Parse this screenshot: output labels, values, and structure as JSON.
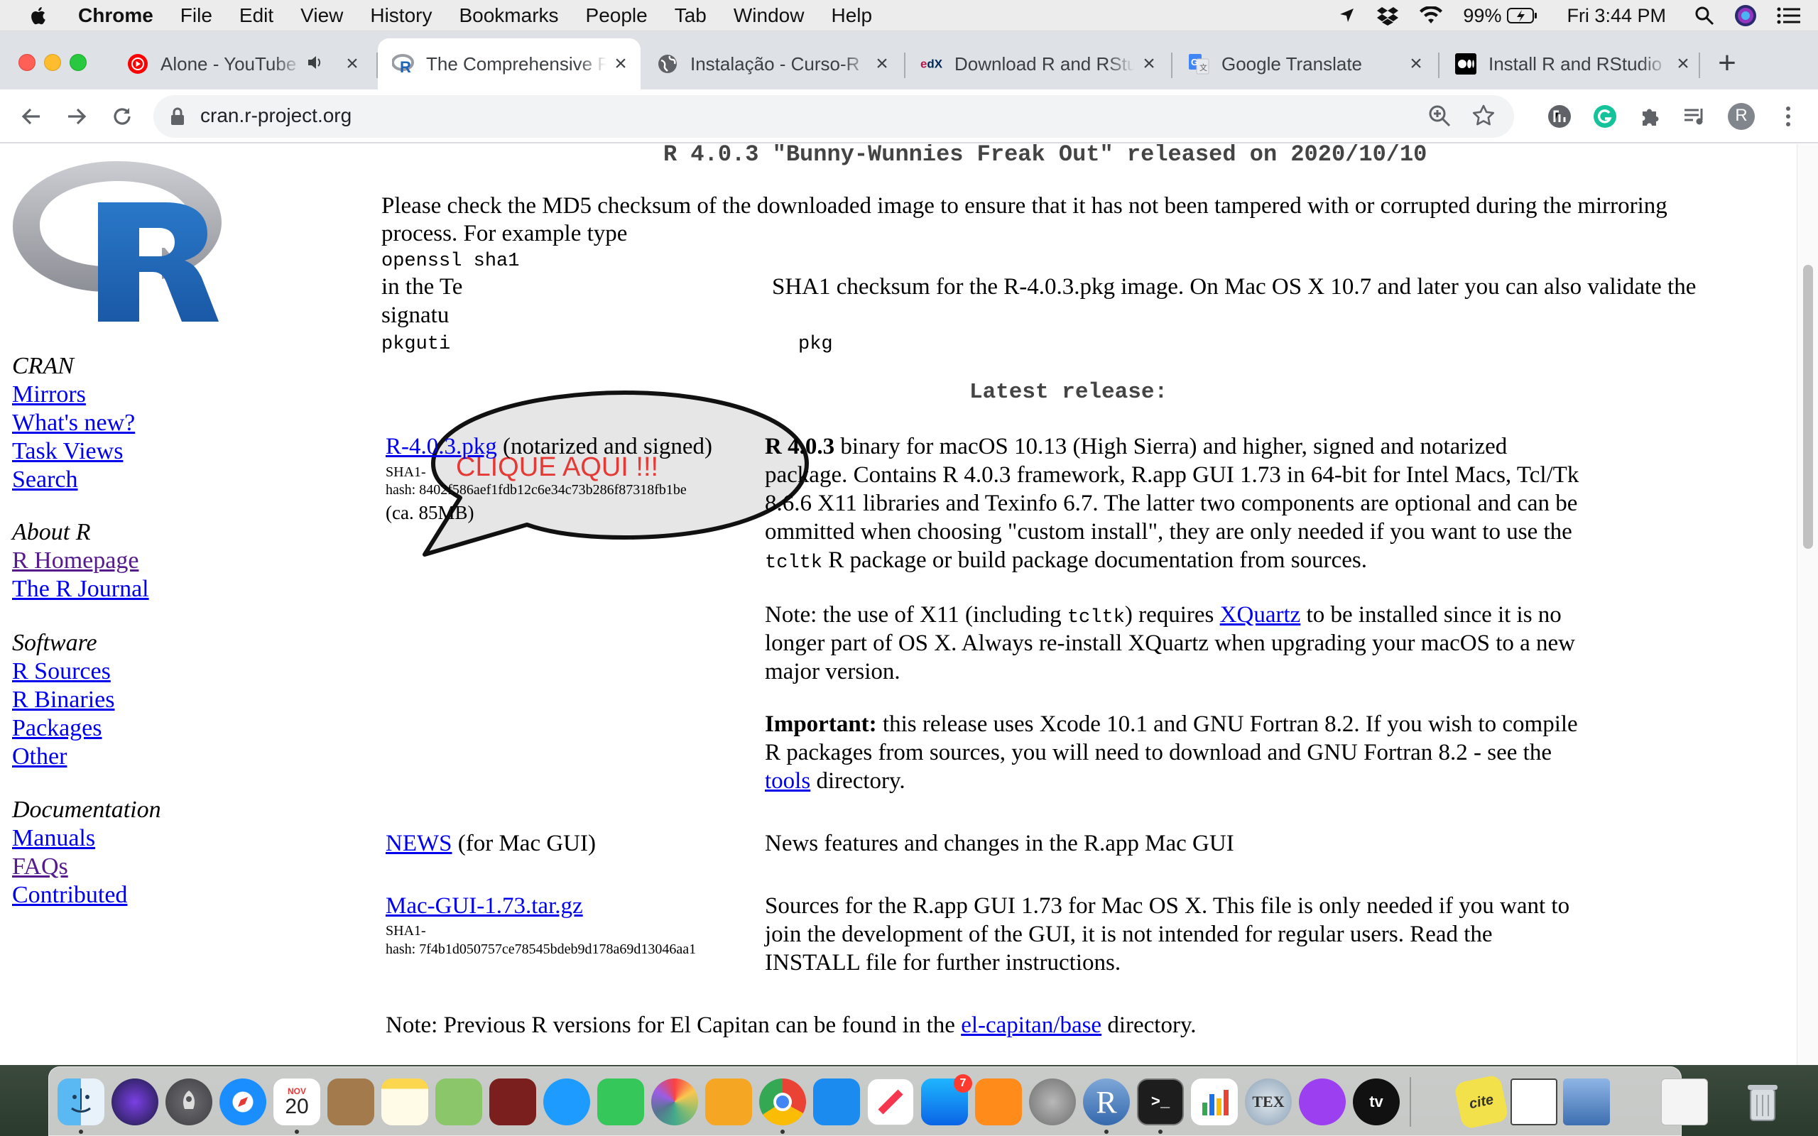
{
  "menubar": {
    "apple_icon": "apple-icon",
    "items": [
      "Chrome",
      "File",
      "Edit",
      "View",
      "History",
      "Bookmarks",
      "People",
      "Tab",
      "Window",
      "Help"
    ],
    "battery": "99%",
    "clock": "Fri 3:44 PM"
  },
  "tabs": [
    {
      "title": "Alone - YouTube Music",
      "icon": "youtube-music-icon",
      "active": false
    },
    {
      "title": "The Comprehensive R Archive Network",
      "icon": "r-logo-icon",
      "active": true
    },
    {
      "title": "Instalação - Curso-R",
      "icon": "globe-icon",
      "active": false
    },
    {
      "title": "Download R and RStudio",
      "icon": "edx-icon",
      "active": false
    },
    {
      "title": "Google Translate",
      "icon": "google-translate-icon",
      "active": false
    },
    {
      "title": "Install R and RStudio",
      "icon": "medium-icon",
      "active": false
    }
  ],
  "toolbar": {
    "url": "cran.r-project.org",
    "profile_initial": "R"
  },
  "sidebar": {
    "cran_heading": "CRAN",
    "cran_links": [
      "Mirrors",
      "What's new?",
      "Task Views",
      "Search"
    ],
    "about_heading": "About R",
    "about_links": [
      "R Homepage",
      "The R Journal"
    ],
    "software_heading": "Software",
    "software_links": [
      "R Sources",
      "R Binaries",
      "Packages",
      "Other"
    ],
    "docs_heading": "Documentation",
    "docs_links": [
      "Manuals",
      "FAQs",
      "Contributed"
    ]
  },
  "content": {
    "release_title": "R 4.0.3 \"Bunny-Wunnies Freak Out\" released on 2020/10/10",
    "md5_line1": "Please check the MD5 checksum of the downloaded image to ensure that it has not been tampered with or corrupted during the mirroring",
    "md5_line2": "process. For example type",
    "openssl_cmd": "openssl sha1",
    "in_the": "in the Te",
    "sha1_rest": "SHA1 checksum for the R-4.0.3.pkg image. On Mac OS X 10.7 and later you can also validate the",
    "signature": "signatu",
    "pkgutil": "pkguti",
    "pkg_end": "pkg",
    "latest_release": "Latest release:",
    "pkg_link": "R-4.0.3.pkg",
    "pkg_note": "(notarized and signed)",
    "pkg_sha_label": "SHA1-",
    "pkg_hash": "hash: 8402f586aef1fdb12c6e34c73b286f87318fb1be",
    "pkg_size": "(ca. 85MB)",
    "desc_bold": "R 4.0.3",
    "desc_l1": " binary for macOS 10.13 (High Sierra) and higher, signed and notarized",
    "desc_l2": "package. Contains R 4.0.3 framework, R.app GUI 1.73 in 64-bit for Intel Macs, Tcl/Tk",
    "desc_l3": "8.6.6 X11 libraries and Texinfo 6.7. The latter two components are optional and can be",
    "desc_l4": "ommitted when choosing \"custom install\", they are only needed if you want to use the",
    "desc_l5_code": "tcltk",
    "desc_l5": " R package or build package documentation from sources.",
    "note_a": "Note: the use of X11 (including ",
    "note_code": "tcltk",
    "note_b": ") requires ",
    "note_link": "XQuartz",
    "note_c": " to be installed since it is no",
    "note_l2": "longer part of OS X. Always re-install XQuartz when upgrading your macOS to a new",
    "note_l3": "major version.",
    "imp_bold": "Important:",
    "imp_l1": " this release uses Xcode 10.1 and GNU Fortran 8.2. If you wish to compile",
    "imp_l2": "R packages from sources, you will need to download and GNU Fortran 8.2 - see the",
    "imp_link": "tools",
    "imp_l3": " directory.",
    "news_link": "NEWS",
    "news_note": " (for Mac GUI)",
    "news_desc": "News features and changes in the R.app Mac GUI",
    "gui_link": "Mac-GUI-1.73.tar.gz",
    "gui_sha_label": "SHA1-",
    "gui_hash": "hash: 7f4b1d050757ce78545bdeb9d178a69d13046aa1",
    "gui_l1": "Sources for the R.app GUI 1.73 for Mac OS X. This file is only needed if you want to",
    "gui_l2": "join the development of the GUI, it is not intended for regular users. Read the",
    "gui_l3": "INSTALL file for further instructions.",
    "prev_a": "Note: Previous R versions for El Capitan can be found in the ",
    "prev_link": "el-capitan/base",
    "prev_b": " directory."
  },
  "overlay": {
    "bubble_text": "CLIQUE AQUI !!!"
  },
  "dock": {
    "calendar_month": "NOV",
    "calendar_day": "20",
    "appstore_badge": "7",
    "r_label": "R",
    "tex_label": "TEX",
    "tv_label": "tv",
    "cite_label": "cite"
  }
}
